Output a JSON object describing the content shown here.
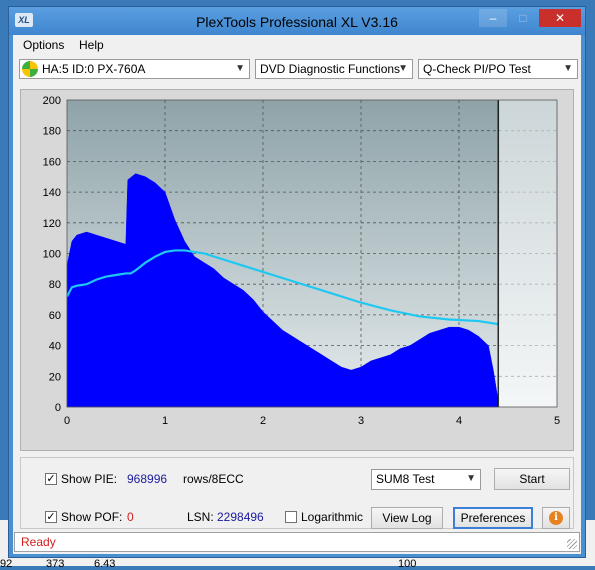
{
  "window": {
    "title": "PlexTools Professional XL V3.16",
    "icon_text": "XL",
    "controls": {
      "minimize": "–",
      "maximize": "□",
      "close": "✕"
    }
  },
  "menu": {
    "options": "Options",
    "help": "Help"
  },
  "toolbar": {
    "drive": "HA:5 ID:0  PX-760A",
    "function": "DVD Diagnostic Functions",
    "test": "Q-Check PI/PO Test"
  },
  "chart_data": {
    "type": "area",
    "xlim": [
      0,
      5
    ],
    "ylim": [
      0,
      200
    ],
    "x_ticks": [
      "0",
      "1",
      "2",
      "3",
      "4",
      "5"
    ],
    "y_ticks": [
      "0",
      "20",
      "40",
      "60",
      "80",
      "100",
      "120",
      "140",
      "160",
      "180",
      "200"
    ],
    "grid": true,
    "end_marker_x": 4.4,
    "series": [
      {
        "color": "#0000ff",
        "x": [
          0,
          0.05,
          0.1,
          0.2,
          0.3,
          0.4,
          0.5,
          0.6,
          0.62,
          0.7,
          0.8,
          0.9,
          1.0,
          1.1,
          1.2,
          1.3,
          1.4,
          1.5,
          1.6,
          1.7,
          1.8,
          1.9,
          2.0,
          2.1,
          2.2,
          2.3,
          2.4,
          2.5,
          2.6,
          2.7,
          2.8,
          2.9,
          3.0,
          3.1,
          3.2,
          3.3,
          3.4,
          3.5,
          3.6,
          3.7,
          3.8,
          3.9,
          4.0,
          4.1,
          4.2,
          4.3,
          4.35,
          4.4
        ],
        "values": [
          92,
          108,
          112,
          114,
          112,
          110,
          108,
          106,
          148,
          152,
          150,
          146,
          140,
          122,
          108,
          98,
          94,
          90,
          84,
          80,
          76,
          70,
          62,
          56,
          50,
          46,
          42,
          38,
          34,
          30,
          26,
          24,
          26,
          30,
          32,
          34,
          38,
          40,
          44,
          48,
          50,
          52,
          52,
          50,
          46,
          40,
          24,
          4
        ]
      },
      {
        "color": "#1ec8f0",
        "x": [
          0,
          0.05,
          0.1,
          0.2,
          0.3,
          0.4,
          0.5,
          0.6,
          0.65,
          0.7,
          0.8,
          0.9,
          1.0,
          1.1,
          1.2,
          1.3,
          1.4,
          1.5,
          1.7,
          2.0,
          2.3,
          2.6,
          3.0,
          3.3,
          3.6,
          3.9,
          4.2,
          4.4
        ],
        "values": [
          72,
          78,
          79,
          80,
          83,
          85,
          86,
          87,
          87,
          89,
          94,
          98,
          101,
          102,
          102,
          101,
          100,
          98,
          94,
          88,
          82,
          76,
          68,
          63,
          59,
          57,
          56,
          54
        ]
      }
    ]
  },
  "controls": {
    "show_pie_label": "Show PIE:",
    "pie_value": "968996",
    "pie_unit": "rows/8ECC",
    "show_poe_label": "Show POF:",
    "poe_value": "0",
    "lsn_label": "LSN:",
    "lsn_value": "2298496",
    "logarithmic_label": "Logarithmic",
    "sum_test": "SUM8 Test",
    "start": "Start",
    "view_log": "View Log",
    "preferences": "Preferences",
    "info_icon": "i",
    "pie_checked": "✓",
    "poe_checked": "✓"
  },
  "status": {
    "text": "Ready"
  },
  "background_text": {
    "a": "92",
    "b": "373",
    "c": "6.43",
    "d": "100"
  },
  "colors": {
    "pie_value": "#1a1aa0",
    "poe_value": "#d02020",
    "status": "#d02020"
  }
}
